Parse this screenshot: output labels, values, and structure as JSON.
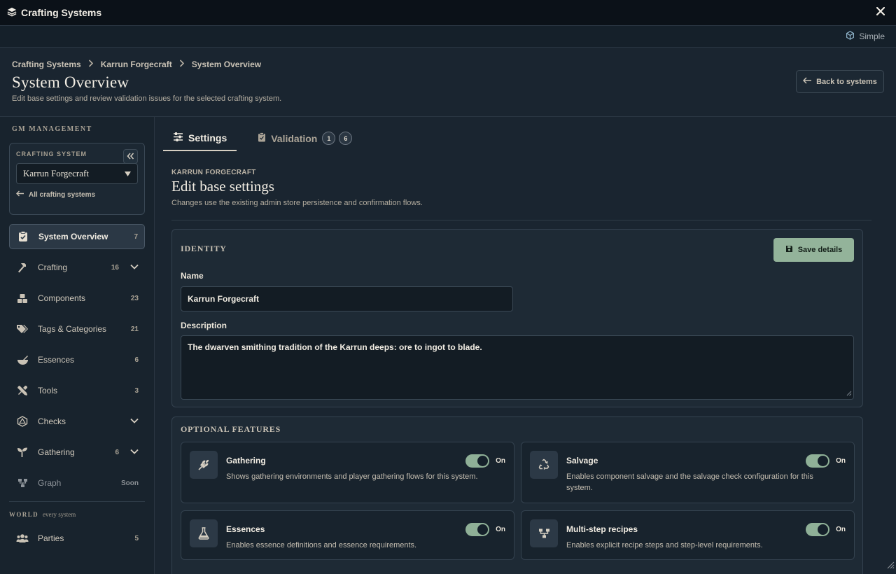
{
  "window": {
    "title": "Crafting Systems"
  },
  "modebar": {
    "mode_label": "Simple"
  },
  "header": {
    "breadcrumb": [
      "Crafting Systems",
      "Karrun Forgecraft",
      "System Overview"
    ],
    "title": "System Overview",
    "subtitle": "Edit base settings and review validation issues for the selected crafting system.",
    "back_label": "Back to systems"
  },
  "sidebar": {
    "section_label": "GM MANAGEMENT",
    "system_card": {
      "label": "CRAFTING SYSTEM",
      "selected": "Karrun Forgecraft",
      "all_link": "All crafting systems"
    },
    "items": [
      {
        "label": "System Overview",
        "count": "7",
        "icon": "clipboard-check-icon"
      },
      {
        "label": "Crafting",
        "count": "16",
        "icon": "hammer-icon"
      },
      {
        "label": "Components",
        "count": "23",
        "icon": "boxes-icon"
      },
      {
        "label": "Tags & Categories",
        "count": "21",
        "icon": "tags-icon"
      },
      {
        "label": "Essences",
        "count": "6",
        "icon": "mortar-pestle-icon"
      },
      {
        "label": "Tools",
        "count": "3",
        "icon": "tools-icon"
      },
      {
        "label": "Checks",
        "count": "",
        "icon": "dice-d20-icon"
      },
      {
        "label": "Gathering",
        "count": "6",
        "icon": "seedling-icon"
      },
      {
        "label": "Graph",
        "count": "Soon",
        "icon": "diagram-icon"
      }
    ],
    "world": {
      "label": "WORLD",
      "sublabel": "every system",
      "items": [
        {
          "label": "Parties",
          "count": "5",
          "icon": "users-icon"
        }
      ]
    }
  },
  "tabs": [
    {
      "label": "Settings",
      "icon": "sliders-icon"
    },
    {
      "label": "Validation",
      "icon": "clipboard-icon",
      "badges": [
        "1",
        "6"
      ]
    }
  ],
  "main": {
    "eyebrow": "KARRUN FORGECRAFT",
    "title": "Edit base settings",
    "subtitle": "Changes use the existing admin store persistence and confirmation flows.",
    "identity": {
      "label": "IDENTITY",
      "save_label": "Save details",
      "name_label": "Name",
      "name_value": "Karrun Forgecraft",
      "description_label": "Description",
      "description_value": "The dwarven smithing tradition of the Karrun deeps: ore to ingot to blade."
    },
    "optional": {
      "label": "OPTIONAL FEATURES",
      "features": [
        {
          "title": "Gathering",
          "desc": "Shows gathering environments and player gathering flows for this system.",
          "state": "On",
          "icon": "wheat-icon"
        },
        {
          "title": "Salvage",
          "desc": "Enables component salvage and the salvage check configuration for this system.",
          "state": "On",
          "icon": "recycle-icon"
        },
        {
          "title": "Essences",
          "desc": "Enables essence definitions and essence requirements.",
          "state": "On",
          "icon": "flask-icon"
        },
        {
          "title": "Multi-step recipes",
          "desc": "Enables explicit recipe steps and step-level requirements.",
          "state": "On",
          "icon": "steps-icon"
        }
      ]
    }
  },
  "colors": {
    "accent": "#93b39a",
    "background": "#1a2530",
    "panel": "#1e2a35"
  }
}
